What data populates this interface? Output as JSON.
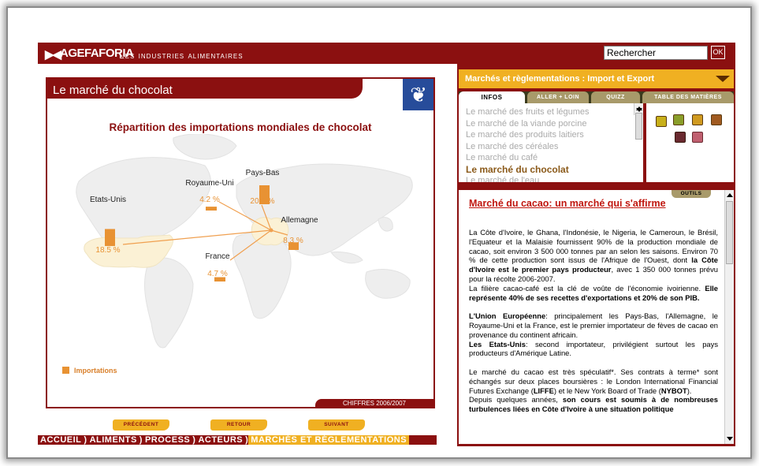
{
  "header": {
    "logo_text": "AGEFAFORIA",
    "app_title": "Les industries alimentaires",
    "search_value": "Rechercher",
    "ok_label": "OK"
  },
  "left_panel": {
    "title": "Le marché du chocolat",
    "figure_source": "CHIFFRES 2006/2007"
  },
  "chart_data": {
    "type": "bar",
    "title": "Répartition des importations mondiales de chocolat",
    "categories": [
      "Etats-Unis",
      "Royaume-Uni",
      "Pays-Bas",
      "France",
      "Allemagne"
    ],
    "series": [
      {
        "name": "Importations",
        "values": [
          18.5,
          4.2,
          20.6,
          4.7,
          8.3
        ]
      }
    ],
    "value_labels": [
      "18.5 %",
      "4.2 %",
      "20.6 %",
      "4.7 %",
      "8.3 %"
    ],
    "unit": "%",
    "legend_position": "bottom-left",
    "colors": {
      "bar": "#e89233",
      "label": "#e89233",
      "arrow": "#f0a050"
    }
  },
  "nav_buttons": {
    "prev": "PRÉCÉDENT",
    "back": "RETOUR",
    "next": "SUIVANT"
  },
  "nav_menu": [
    "ACCUEIL",
    "ALIMENTS",
    "PROCESS",
    "ACTEURS",
    "MARCHÉS ET RÉGLEMENTATIONS"
  ],
  "right_panel": {
    "section_title": "Marchés et règlementations : Import et Export",
    "tabs": [
      "INFOS",
      "ALLER + LOIN",
      "QUIZZ",
      "TABLE DES MATIÈRES"
    ],
    "info_list": [
      "Le marché des fruits et légumes",
      "Le marché de la viande porcine",
      "Le marché des produits laitiers",
      "Le marché des céréales",
      "Le marché du café",
      "Le marché du chocolat",
      "Le marché de l'eau"
    ],
    "tools_label": "OUTILS",
    "article": {
      "title": "Marché du cacao: un marché qui s'affirme",
      "p1_a": "La Côte d'Ivoire, le Ghana, l'Indonésie, le Nigeria, le Cameroun, le Brésil, l'Equateur et la Malaisie fournissent 90% de la production mondiale de cacao, soit environ 3 500 000 tonnes par an selon les saisons. Environ 70 % de cette production sont issus de l'Afrique de l'Ouest, dont ",
      "p1_b": "la Côte d'Ivoire est le premier pays producteur",
      "p1_c": ", avec 1 350 000 tonnes prévu pour la récolte 2006-2007.",
      "p2_a": "La filière cacao-café est la clé de voûte de l'économie ivoirienne. ",
      "p2_b": "Elle représente 40% de ses recettes d'exportations et 20% de son PIB.",
      "p3_a": "L'Union Européenne",
      "p3_b": ":  principalement les Pays-Bas, l'Allemagne, le Royaume-Uni et la France, est le premier importateur de fèves de cacao en provenance du continent africain.",
      "p4_a": "Les Etats-Unis",
      "p4_b": ": second importateur, privilégient surtout les pays producteurs d'Amérique Latine.",
      "p5_a": "Le marché du cacao est très spéculatif*. Ses contrats à terme* sont échangés sur deux places boursières : le London International Financial Futures Exchange (",
      "p5_b": "LIFFE",
      "p5_c": ") et le New York Board of Trade (",
      "p5_d": "NYBOT",
      "p5_e": ").",
      "p6_a": "Depuis quelques années, ",
      "p6_b": "son cours est soumis à de nombreuses turbulences liées en Côte d'Ivoire à une situation politique"
    }
  }
}
